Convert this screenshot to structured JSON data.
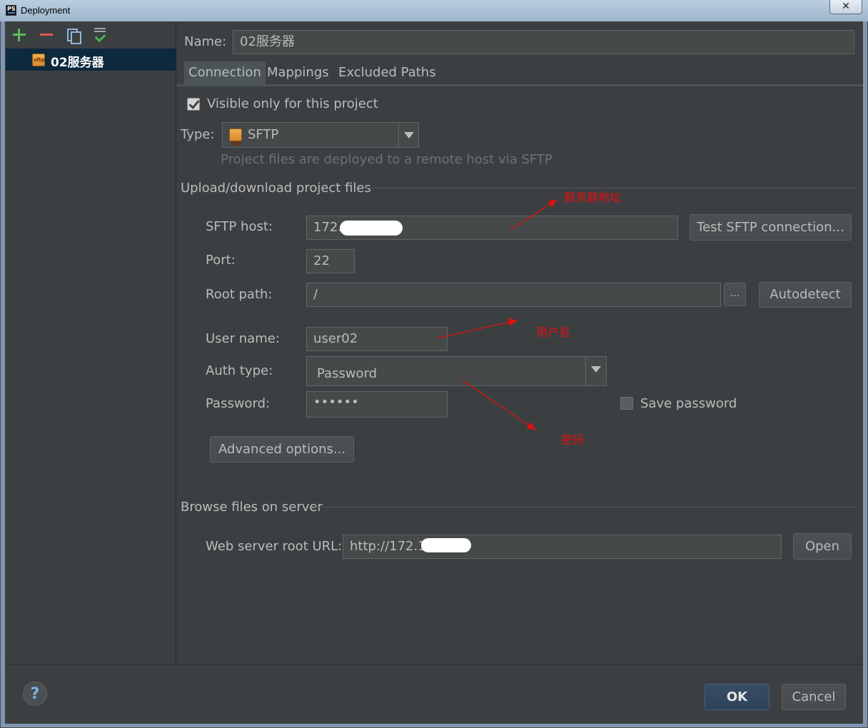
{
  "window": {
    "title": "Deployment"
  },
  "toolbar": {
    "add": "add",
    "remove": "remove",
    "copy": "copy",
    "set_default": "set-default"
  },
  "servers": [
    {
      "badge": "sftp",
      "name": "02服务器",
      "selected": true
    }
  ],
  "form": {
    "name_label": "Name:",
    "name_value": "02服务器",
    "tabs": [
      "Connection",
      "Mappings",
      "Excluded Paths"
    ],
    "active_tab": 0,
    "visible_only_label": "Visible only for this project",
    "visible_only_checked": true,
    "type_label": "Type:",
    "type_badge": "sftp",
    "type_value": "SFTP",
    "type_hint": "Project files are deployed to a remote host via SFTP",
    "upload_section": "Upload/download project files",
    "host_label": "SFTP host:",
    "host_value": "172.",
    "test_button": "Test SFTP connection...",
    "port_label": "Port:",
    "port_value": "22",
    "root_label": "Root path:",
    "root_value": "/",
    "browse_button": "...",
    "autodetect_button": "Autodetect",
    "user_label": "User name:",
    "user_value": "user02",
    "auth_label": "Auth type:",
    "auth_value": "Password",
    "password_label": "Password:",
    "password_value": "••••••",
    "save_password_label": "Save password",
    "save_password_checked": false,
    "advanced_button": "Advanced options...",
    "browse_section": "Browse files on server",
    "web_url_label": "Web server root URL:",
    "web_url_value": "http://172.1",
    "open_button": "Open"
  },
  "annotations": {
    "server_address": "服务器地址",
    "username": "用户名",
    "password": "密码",
    "color": "#e01010"
  },
  "footer": {
    "help": "?",
    "ok": "OK",
    "cancel": "Cancel"
  },
  "colors": {
    "background": "#3c3f41",
    "selection": "#0d293e",
    "field": "#45494a",
    "text": "#bbbbbb"
  }
}
